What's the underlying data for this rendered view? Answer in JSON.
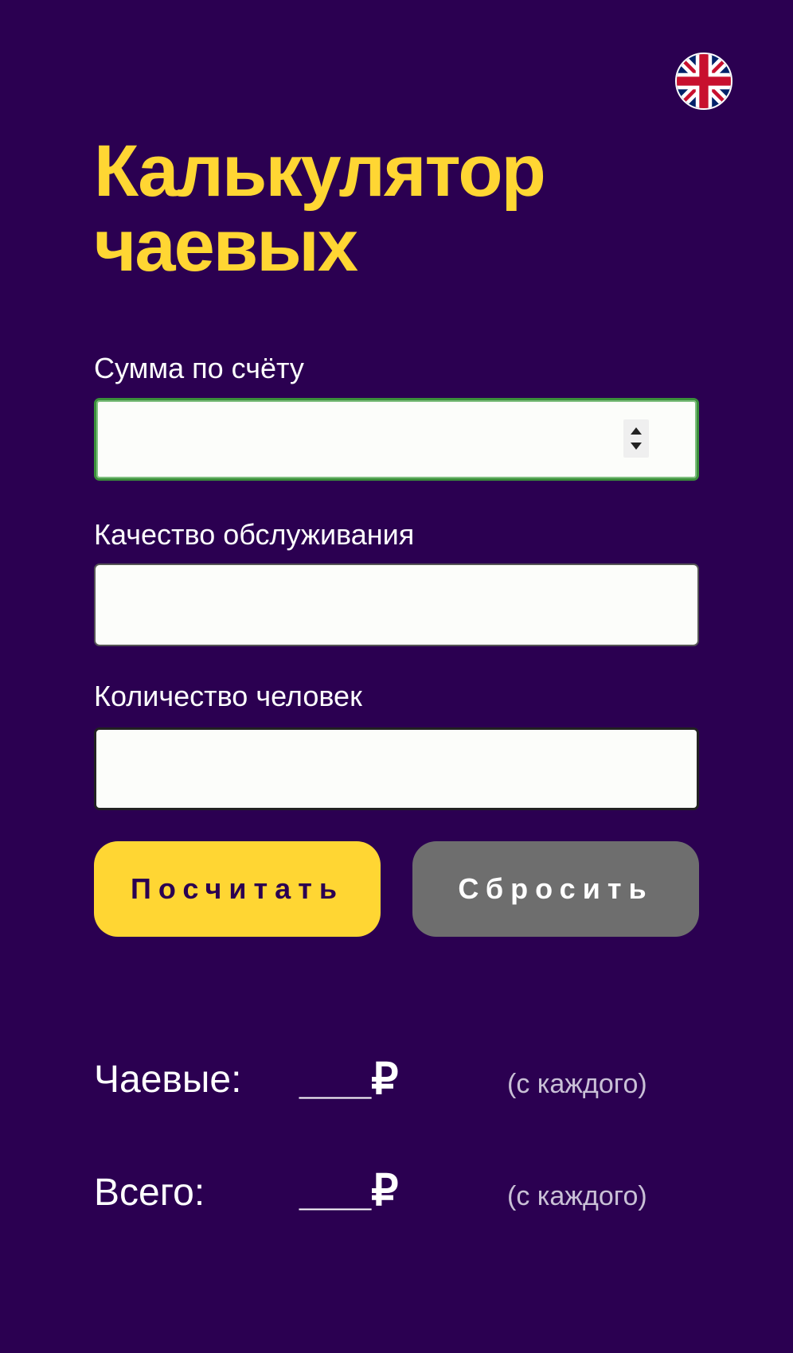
{
  "header": {
    "title_line1": "Калькулятор",
    "title_line2": "чаевых",
    "language_icon": "uk-flag-icon"
  },
  "form": {
    "bill_label": "Сумма по счёту",
    "bill_value": "",
    "service_label": "Качество обслуживания",
    "service_value": "",
    "people_label": "Количество человек",
    "people_value": ""
  },
  "buttons": {
    "calculate": "Посчитать",
    "reset": "Сбросить"
  },
  "results": {
    "tip_label": "Чаевые:",
    "tip_value": "___₽",
    "tip_note": "(с каждого)",
    "total_label": "Всего:",
    "total_value": "___₽",
    "total_note": "(с каждого)"
  },
  "colors": {
    "background": "#2b0051",
    "accent": "#ffd633",
    "reset_button": "#6e6e6e",
    "focus_border": "#3b8f3b"
  }
}
